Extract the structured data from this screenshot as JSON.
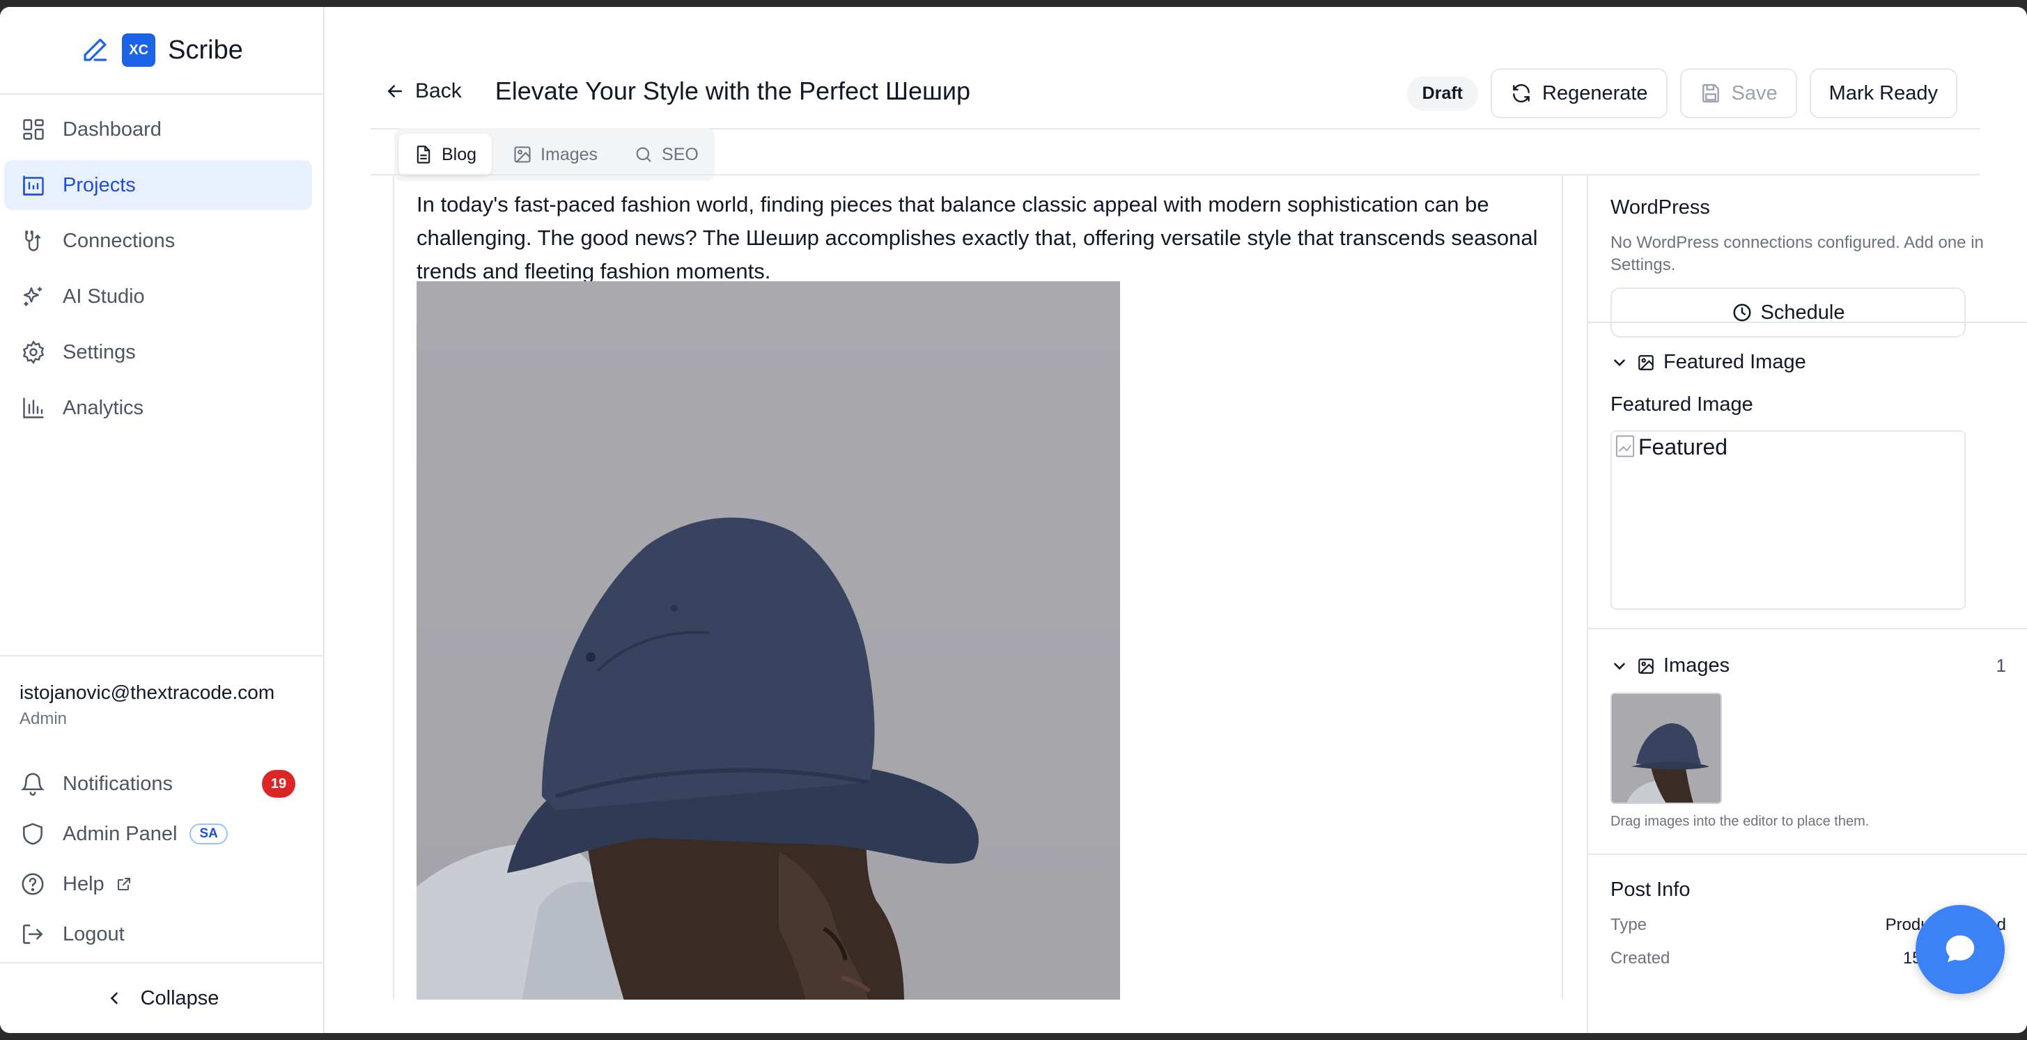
{
  "app": {
    "name": "Scribe",
    "logo_text": "XC"
  },
  "sidebar": {
    "items": [
      {
        "label": "Dashboard",
        "icon": "dashboard-icon"
      },
      {
        "label": "Projects",
        "icon": "projects-icon",
        "active": true
      },
      {
        "label": "Connections",
        "icon": "connections-icon"
      },
      {
        "label": "AI Studio",
        "icon": "sparkles-icon"
      },
      {
        "label": "Settings",
        "icon": "gear-icon"
      },
      {
        "label": "Analytics",
        "icon": "bar-chart-icon"
      }
    ],
    "user": {
      "email": "istojanovic@thextracode.com",
      "role": "Admin"
    },
    "utilities": {
      "notifications": {
        "label": "Notifications",
        "count": "19"
      },
      "admin_panel": {
        "label": "Admin Panel",
        "badge": "SA"
      },
      "help": {
        "label": "Help"
      },
      "logout": {
        "label": "Logout"
      }
    },
    "collapse_label": "Collapse"
  },
  "header": {
    "back_label": "Back",
    "title": "Elevate Your Style with the Perfect Шешир",
    "status": "Draft",
    "regenerate_label": "Regenerate",
    "save_label": "Save",
    "mark_ready_label": "Mark Ready"
  },
  "tabs": [
    {
      "label": "Blog",
      "active": true
    },
    {
      "label": "Images"
    },
    {
      "label": "SEO"
    }
  ],
  "editor": {
    "paragraph": "In today's fast-paced fashion world, finding pieces that balance classic appeal with modern sophistication can be challenging. The good news? The Шешир accomplishes exactly that, offering versatile style that transcends seasonal trends and fleeting fashion moments."
  },
  "panel": {
    "wordpress": {
      "title": "WordPress",
      "message": "No WordPress connections configured. Add one in Settings.",
      "schedule_label": "Schedule"
    },
    "featured": {
      "section_title": "Featured Image",
      "label": "Featured Image",
      "alt_text": "Featured"
    },
    "images": {
      "section_title": "Images",
      "count": "1",
      "hint": "Drag images into the editor to place them."
    },
    "post_info": {
      "title": "Post Info",
      "type_key": "Type",
      "type_value": "Product focused",
      "created_key": "Created",
      "created_value": "15/03"
    }
  },
  "colors": {
    "accent": "#1d63e8",
    "active_bg": "#e8f0fe",
    "badge_red": "#dc2626",
    "fab": "#3b82f6"
  }
}
